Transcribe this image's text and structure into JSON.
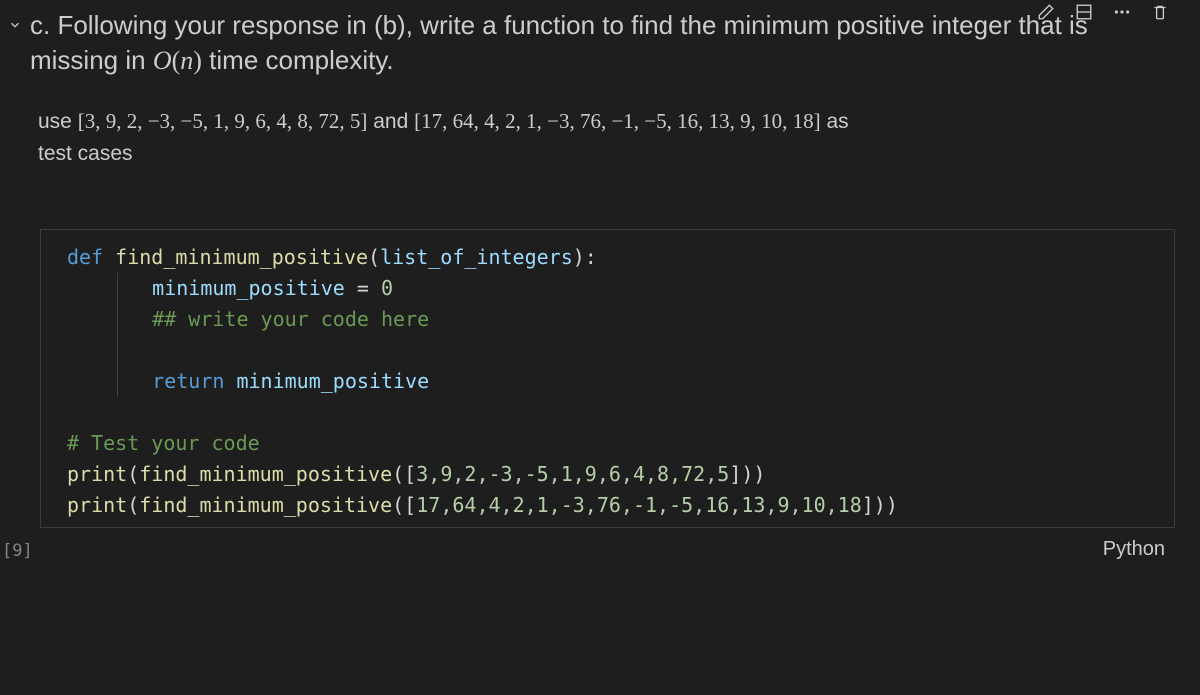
{
  "toolbar": {
    "icons": [
      "edit-icon",
      "split-icon",
      "more-icon",
      "delete-icon"
    ]
  },
  "markdown": {
    "question_prefix": "c. Following your response in (b), write a function to find the minimum positive integer that is missing in ",
    "big_o_expr": "O(n)",
    "question_suffix": " time complexity.",
    "test_prefix": "use ",
    "test_list1": "[3, 9, 2, −3, −5, 1, 9, 6, 4, 8, 72, 5]",
    "test_mid": " and ",
    "test_list2": "[17, 64, 4, 2, 1, −3, 76, −1, −5, 16, 13, 9, 10, 18]",
    "test_suffix_as": " as",
    "test_line2": "test cases"
  },
  "code": {
    "l1_def": "def",
    "l1_name": "find_minimum_positive",
    "l1_open": "(",
    "l1_param": "list_of_integers",
    "l1_close": "):",
    "l2_var": "minimum_positive",
    "l2_eq": " = ",
    "l2_val": "0",
    "l3_comment": "## write your code here",
    "l5_ret": "return",
    "l5_var": " minimum_positive",
    "l7_comment": "# Test your code",
    "l8_print": "print",
    "l8_open": "(",
    "l8_call": "find_minimum_positive",
    "l8_args_open": "([",
    "l8_args": "3,9,2,-3,-5,1,9,6,4,8,72,5",
    "l8_args_close": "]))",
    "l9_print": "print",
    "l9_open": "(",
    "l9_call": "find_minimum_positive",
    "l9_args_open": "([",
    "l9_args": "17,64,4,2,1,-3,76,-1,-5,16,13,9,10,18",
    "l9_args_close": "]))"
  },
  "footer": {
    "exec_count": "[9]",
    "language": "Python"
  }
}
